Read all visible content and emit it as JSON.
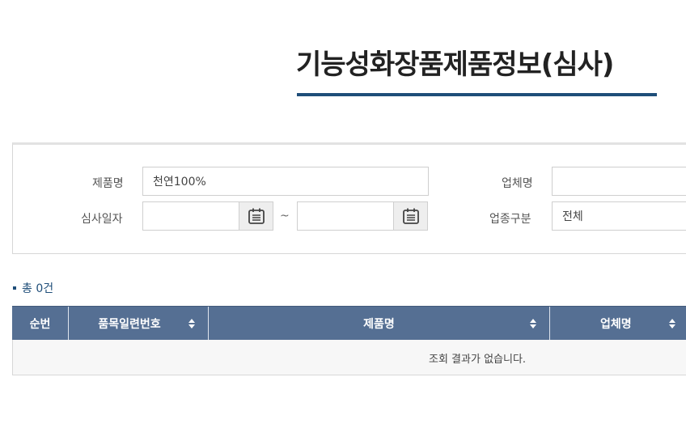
{
  "page": {
    "title": "기능성화장품제품정보(심사)"
  },
  "search": {
    "product_name_label": "제품명",
    "product_name_value": "천연100%",
    "company_name_label": "업체명",
    "company_name_value": "",
    "review_date_label": "심사일자",
    "date_from_value": "",
    "date_to_value": "",
    "date_separator": "~",
    "business_type_label": "업종구분",
    "business_type_selected": "전체"
  },
  "results": {
    "total_text": "총 0건",
    "columns": [
      "순번",
      "품목일련번호",
      "제품명",
      "업체명"
    ],
    "empty_message": "조회 결과가 없습니다."
  },
  "colors": {
    "accent": "#1f4e79",
    "table_header": "#556f93"
  }
}
